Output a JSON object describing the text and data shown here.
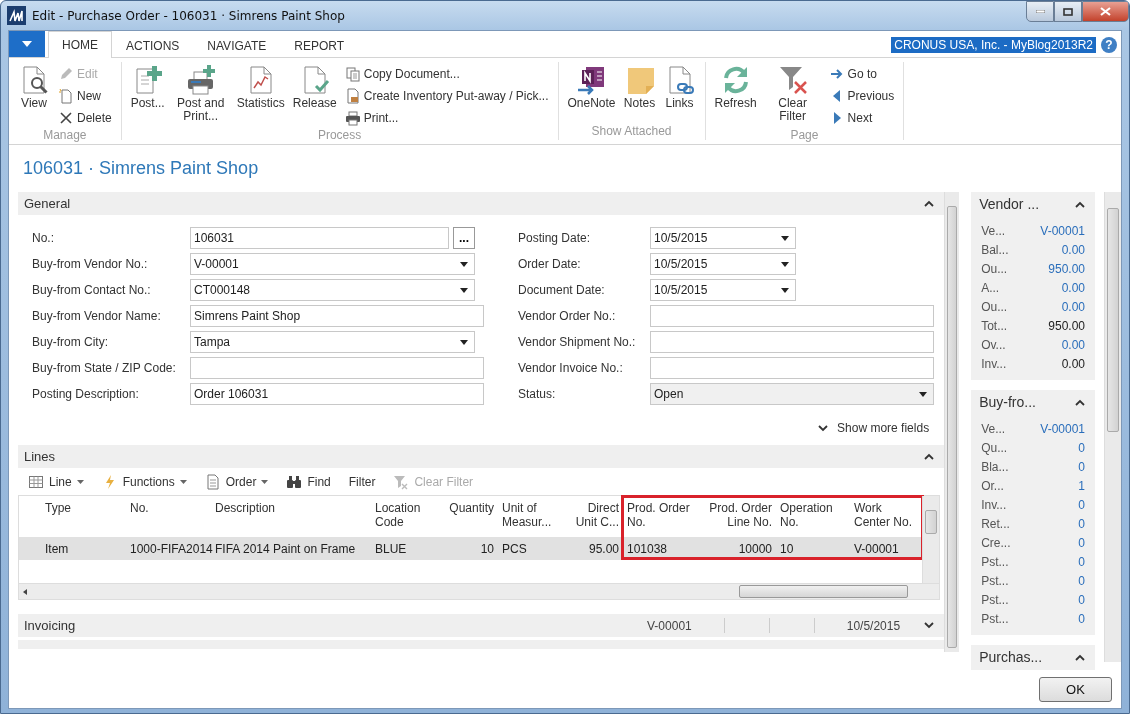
{
  "window": {
    "title": "Edit - Purchase Order - 106031 · Simrens Paint Shop"
  },
  "ribbon": {
    "tabs": [
      {
        "label": "HOME",
        "selected": true
      },
      {
        "label": "ACTIONS",
        "selected": false
      },
      {
        "label": "NAVIGATE",
        "selected": false
      },
      {
        "label": "REPORT",
        "selected": false
      }
    ],
    "company": "CRONUS USA, Inc. - MyBlog2013R2",
    "help": "?",
    "groups": [
      {
        "label": "Manage",
        "items": [
          {
            "label": "View",
            "kind": "large",
            "disabled": false
          },
          {
            "label": "Edit",
            "kind": "small",
            "disabled": true
          },
          {
            "label": "New",
            "kind": "small",
            "disabled": false
          },
          {
            "label": "Delete",
            "kind": "small",
            "disabled": false
          }
        ]
      },
      {
        "label": "Process",
        "items": [
          {
            "label": "Post...",
            "kind": "large",
            "disabled": false
          },
          {
            "label": "Post and Print...",
            "kind": "large",
            "disabled": false
          },
          {
            "label": "Statistics",
            "kind": "large",
            "disabled": false
          },
          {
            "label": "Release",
            "kind": "large",
            "disabled": false
          },
          {
            "label": "Copy Document...",
            "kind": "small",
            "disabled": false
          },
          {
            "label": "Create Inventory Put-away / Pick...",
            "kind": "small",
            "disabled": false
          },
          {
            "label": "Print...",
            "kind": "small",
            "disabled": false
          }
        ]
      },
      {
        "label": "Show Attached",
        "items": [
          {
            "label": "OneNote",
            "kind": "large",
            "disabled": false
          },
          {
            "label": "Notes",
            "kind": "large",
            "disabled": false
          },
          {
            "label": "Links",
            "kind": "large",
            "disabled": false
          }
        ]
      },
      {
        "label": "Page",
        "items": [
          {
            "label": "Refresh",
            "kind": "large",
            "disabled": false
          },
          {
            "label": "Clear Filter",
            "kind": "large",
            "disabled": false
          },
          {
            "label": "Go to",
            "kind": "small",
            "disabled": false
          },
          {
            "label": "Previous",
            "kind": "small",
            "disabled": false
          },
          {
            "label": "Next",
            "kind": "small",
            "disabled": false
          }
        ]
      }
    ]
  },
  "page_title": "106031 · Simrens Paint Shop",
  "general": {
    "title": "General",
    "expanded": true,
    "columns": [
      [
        {
          "label": "No.:",
          "value": "106031",
          "kind": "lookup",
          "button": "..."
        },
        {
          "label": "Buy-from Vendor No.:",
          "value": "V-00001",
          "kind": "dropdown"
        },
        {
          "label": "Buy-from Contact No.:",
          "value": "CT000148",
          "kind": "dropdown"
        },
        {
          "label": "Buy-from Vendor Name:",
          "value": "Simrens Paint Shop",
          "kind": "text"
        },
        {
          "label": "Buy-from City:",
          "value": "Tampa",
          "kind": "dropdown"
        },
        {
          "label": "Buy-from State / ZIP Code:",
          "kind": "text"
        },
        {
          "label": "Posting Description:",
          "value": "Order 106031",
          "kind": "text"
        }
      ],
      [
        {
          "label": "Posting Date:",
          "value": "10/5/2015",
          "kind": "date"
        },
        {
          "label": "Order Date:",
          "value": "10/5/2015",
          "kind": "date"
        },
        {
          "label": "Document Date:",
          "value": "10/5/2015",
          "kind": "date"
        },
        {
          "label": "Vendor Order No.:",
          "kind": "text"
        },
        {
          "label": "Vendor Shipment No.:",
          "kind": "text"
        },
        {
          "label": "Vendor Invoice No.:",
          "kind": "text"
        },
        {
          "label": "Status:",
          "value": "Open",
          "kind": "static-dropdown"
        }
      ]
    ],
    "show_more": "Show more fields"
  },
  "lines": {
    "title": "Lines",
    "expanded": true,
    "toolbar": [
      {
        "label": "Line",
        "dropdown": true,
        "disabled": false
      },
      {
        "label": "Functions",
        "dropdown": true,
        "disabled": false
      },
      {
        "label": "Order",
        "dropdown": true,
        "disabled": false
      },
      {
        "label": "Find",
        "dropdown": false,
        "disabled": false
      },
      {
        "label": "Filter",
        "dropdown": false,
        "disabled": false
      },
      {
        "label": "Clear Filter",
        "dropdown": false,
        "disabled": true
      }
    ],
    "columns": [
      {
        "label": "Type",
        "highlighted": false
      },
      {
        "label": "No.",
        "highlighted": false
      },
      {
        "label": "Description",
        "highlighted": false
      },
      {
        "label": "Location Code",
        "highlighted": false
      },
      {
        "label": "Quantity",
        "highlighted": false
      },
      {
        "label": "Unit of Measur...",
        "highlighted": false
      },
      {
        "label": "Direct Unit C...",
        "highlighted": false
      },
      {
        "label": "Prod. Order No.",
        "highlighted": true
      },
      {
        "label": "Prod. Order Line No.",
        "highlighted": true
      },
      {
        "label": "Operation No.",
        "highlighted": true
      },
      {
        "label": "Work Center No.",
        "highlighted": true
      }
    ],
    "rows": [
      {
        "selected": true,
        "cells": [
          "Item",
          "1000-FIFA2014",
          "FIFA 2014 Paint on Frame",
          "BLUE",
          "10",
          "PCS",
          "95.00",
          "101038",
          "10000",
          "10",
          "V-00001"
        ]
      }
    ]
  },
  "invoicing": {
    "title": "Invoicing",
    "expanded": false,
    "summary": [
      "V-00001",
      "10/5/2015"
    ]
  },
  "factboxes": [
    {
      "title": "Vendor ...",
      "expanded": true,
      "rows": [
        {
          "label": "Ve...",
          "value": "V-00001",
          "link": true
        },
        {
          "label": "Bal...",
          "value": "0.00",
          "link": true
        },
        {
          "label": "Ou...",
          "value": "950.00",
          "link": true
        },
        {
          "label": "A...",
          "value": "0.00",
          "link": true
        },
        {
          "label": "Ou...",
          "value": "0.00",
          "link": true
        },
        {
          "label": "Tot...",
          "value": "950.00",
          "link": false
        },
        {
          "label": "Ov...",
          "value": "0.00",
          "link": true
        },
        {
          "label": "Inv...",
          "value": "0.00",
          "link": false
        }
      ]
    },
    {
      "title": "Buy-fro...",
      "expanded": true,
      "rows": [
        {
          "label": "Ve...",
          "value": "V-00001",
          "link": true
        },
        {
          "label": "Qu...",
          "value": "0",
          "link": true
        },
        {
          "label": "Bla...",
          "value": "0",
          "link": true
        },
        {
          "label": "Or...",
          "value": "1",
          "link": true
        },
        {
          "label": "Inv...",
          "value": "0",
          "link": true
        },
        {
          "label": "Ret...",
          "value": "0",
          "link": true
        },
        {
          "label": "Cre...",
          "value": "0",
          "link": true
        },
        {
          "label": "Pst...",
          "value": "0",
          "link": true
        },
        {
          "label": "Pst...",
          "value": "0",
          "link": true
        },
        {
          "label": "Pst...",
          "value": "0",
          "link": true
        },
        {
          "label": "Pst...",
          "value": "0",
          "link": true
        }
      ]
    },
    {
      "title": "Purchas...",
      "expanded": true
    }
  ],
  "buttons": [
    "OK"
  ]
}
